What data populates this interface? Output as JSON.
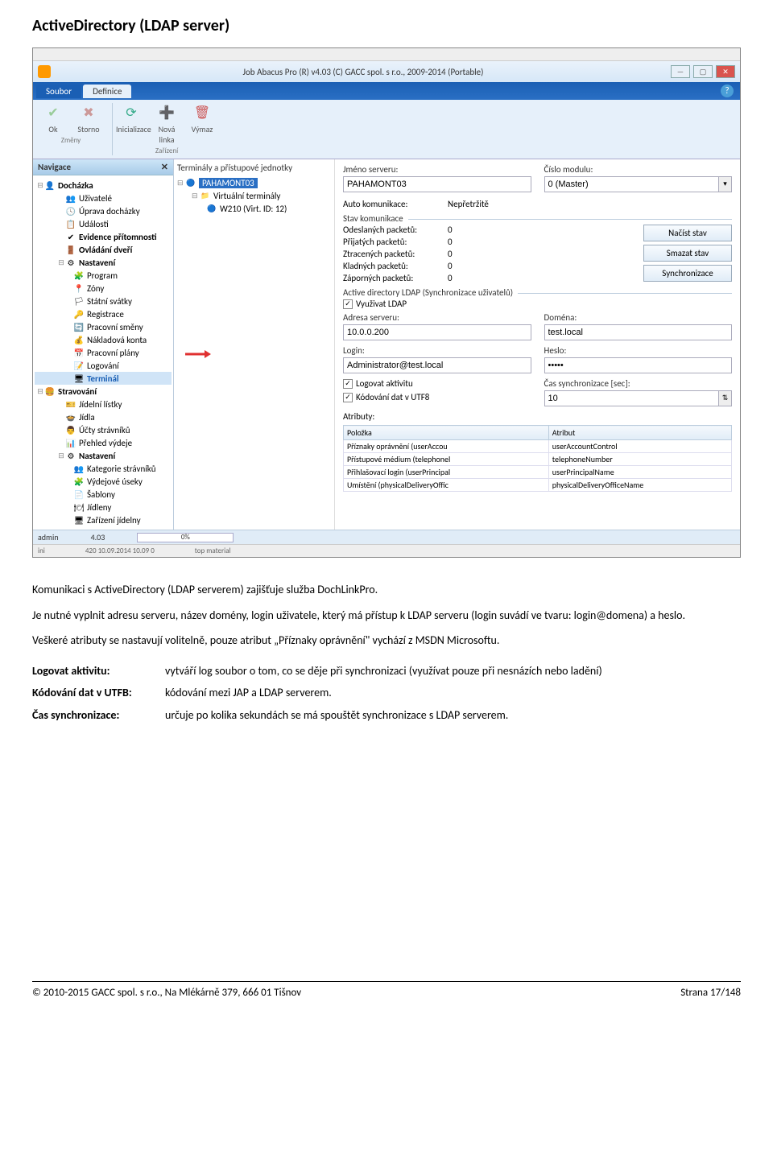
{
  "heading": "ActiveDirectory (LDAP server)",
  "behind_top": {
    "a": "",
    "b": "",
    "c": ""
  },
  "app": {
    "title": "Job Abacus Pro (R) v4.03 (C) GACC spol. s r.o., 2009-2014 (Portable)",
    "menu": {
      "soubor": "Soubor",
      "definice": "Definice"
    },
    "ribbon": {
      "ok": "Ok",
      "storno": "Storno",
      "inicializace": "Inicializace",
      "nova_linka": "Nová linka",
      "vymaz": "Výmaz",
      "grp_zmeny": "Změny",
      "grp_zarizeni": "Zařízení"
    },
    "nav": {
      "title": "Navigace",
      "items": [
        {
          "expand": "⊟",
          "icon": "👤",
          "label": "Docházka",
          "bold": true,
          "cls": ""
        },
        {
          "icon": "👥",
          "label": "Uživatelé",
          "cls": "indent"
        },
        {
          "icon": "🕓",
          "label": "Úprava docházky",
          "cls": "indent"
        },
        {
          "icon": "📋",
          "label": "Události",
          "cls": "indent"
        },
        {
          "icon": "✔",
          "label": "Evidence přítomnosti",
          "bold": true,
          "cls": "indent"
        },
        {
          "icon": "🚪",
          "label": "Ovládání dveří",
          "bold": true,
          "cls": "indent"
        },
        {
          "expand": "⊟",
          "icon": "⚙",
          "label": "Nastavení",
          "bold": true,
          "cls": "indent"
        },
        {
          "icon": "🧩",
          "label": "Program",
          "cls": "indent2"
        },
        {
          "icon": "📍",
          "label": "Zóny",
          "cls": "indent2"
        },
        {
          "icon": "🏳",
          "label": "Státní svátky",
          "cls": "indent2"
        },
        {
          "icon": "🔑",
          "label": "Registrace",
          "cls": "indent2"
        },
        {
          "icon": "🔄",
          "label": "Pracovní směny",
          "cls": "indent2"
        },
        {
          "icon": "💰",
          "label": "Nákladová konta",
          "cls": "indent2"
        },
        {
          "icon": "📅",
          "label": "Pracovní plány",
          "cls": "indent2"
        },
        {
          "icon": "📝",
          "label": "Logování",
          "cls": "indent2"
        },
        {
          "icon": "🖥",
          "label": "Terminál",
          "bold": true,
          "cls": "indent2 selected"
        },
        {
          "expand": "⊟",
          "icon": "🍔",
          "label": "Stravování",
          "bold": true,
          "cls": ""
        },
        {
          "icon": "🎫",
          "label": "Jídelní lístky",
          "cls": "indent"
        },
        {
          "icon": "🍲",
          "label": "Jídla",
          "cls": "indent"
        },
        {
          "icon": "👨",
          "label": "Účty strávníků",
          "cls": "indent"
        },
        {
          "icon": "📊",
          "label": "Přehled výdeje",
          "cls": "indent"
        },
        {
          "expand": "⊟",
          "icon": "⚙",
          "label": "Nastavení",
          "bold": true,
          "cls": "indent"
        },
        {
          "icon": "👥",
          "label": "Kategorie strávníků",
          "cls": "indent2"
        },
        {
          "icon": "🧩",
          "label": "Výdejové úseky",
          "cls": "indent2"
        },
        {
          "icon": "📄",
          "label": "Šablony",
          "cls": "indent2"
        },
        {
          "icon": "🍽",
          "label": "Jídleny",
          "cls": "indent2"
        },
        {
          "icon": "🖥",
          "label": "Zařízení jídelny",
          "cls": "indent2"
        }
      ]
    },
    "tree": {
      "title": "Terminály a přístupové jednotky",
      "root_label": "PAHAMONT03",
      "sub_label": "Virtuální terminály",
      "leaf_label": "W210 (Virt. ID: 12)"
    },
    "form": {
      "jmeno_serveru_lbl": "Jméno serveru:",
      "jmeno_serveru_val": "PAHAMONT03",
      "cislo_modulu_lbl": "Číslo modulu:",
      "cislo_modulu_val": "0 (Master)",
      "auto_kom_lbl": "Auto komunikace:",
      "auto_kom_val": "Nepřetržitě",
      "stav_legend": "Stav komunikace",
      "stats": {
        "odeslanych": "Odeslaných packetů:",
        "odeslanych_v": "0",
        "prijatych": "Přijatých packetů:",
        "prijatych_v": "0",
        "ztracenych": "Ztracených packetů:",
        "ztracenych_v": "0",
        "kladnych": "Kladných packetů:",
        "kladnych_v": "0",
        "zapornych": "Záporných packetů:",
        "zapornych_v": "0"
      },
      "btn_nacist": "Načíst stav",
      "btn_smazat": "Smazat stav",
      "btn_sync": "Synchronizace",
      "ldap_legend": "Active directory LDAP (Synchronizace uživatelů)",
      "vyuzivat_ldap": "Využivat LDAP",
      "adresa_lbl": "Adresa serveru:",
      "adresa_val": "10.0.0.200",
      "domena_lbl": "Doména:",
      "domena_val": "test.local",
      "login_lbl": "Login:",
      "login_val": "Administrator@test.local",
      "heslo_lbl": "Heslo:",
      "heslo_val": "•••••",
      "logovat": "Logovat aktivitu",
      "kodovani": "Kódování dat v UTF8",
      "cas_sync_lbl": "Čas synchronizace [sec]:",
      "cas_sync_val": "10",
      "atributy_lbl": "Atributy:",
      "col_polozka": "Položka",
      "col_atribut": "Atribut",
      "rows": [
        {
          "p": "Příznaky oprávnění (userAccou",
          "a": "userAccountControl"
        },
        {
          "p": "Přístupové médium (telephonel",
          "a": "telephoneNumber"
        },
        {
          "p": "Přihlašovací login (userPrincipal",
          "a": "userPrincipalName"
        },
        {
          "p": "Umístění (physicalDeliveryOffic",
          "a": "physicalDeliveryOfficeName"
        }
      ]
    },
    "status": {
      "user": "admin",
      "ver": "4.03",
      "progress": "0%"
    },
    "behind_bottom": {
      "a": "ini",
      "b": "420 10.09.2014 10.09 0",
      "c": "top material"
    }
  },
  "body": {
    "p1": "Komunikaci s ActiveDirectory (LDAP serverem) zajišťuje služba DochLinkPro.",
    "p2": "Je nutné vyplnit adresu serveru, název domény, login uživatele, který má přístup k LDAP serveru (login suvádí ve tvaru: login@domena) a heslo.",
    "p3": "Veškeré atributy se nastavují volitelně, pouze atribut „Příznaky oprávnění\" vychází z MSDN Microsoftu.",
    "defs": [
      {
        "term": "Logovat aktivitu:",
        "desc": "vytváří log soubor o tom, co se děje při synchronizaci (využívat pouze při nesnázích nebo ladění)"
      },
      {
        "term": "Kódování dat v UTFB:",
        "desc": "kódování mezi JAP a LDAP serverem."
      },
      {
        "term": "Čas synchronizace:",
        "desc": "určuje po kolika sekundách se má spouštět synchronizace s LDAP serverem."
      }
    ]
  },
  "footer": {
    "left": "© 2010-2015 GACC spol. s r.o., Na Mlékárně 379, 666 01 Tišnov",
    "right": "Strana 17/148"
  }
}
